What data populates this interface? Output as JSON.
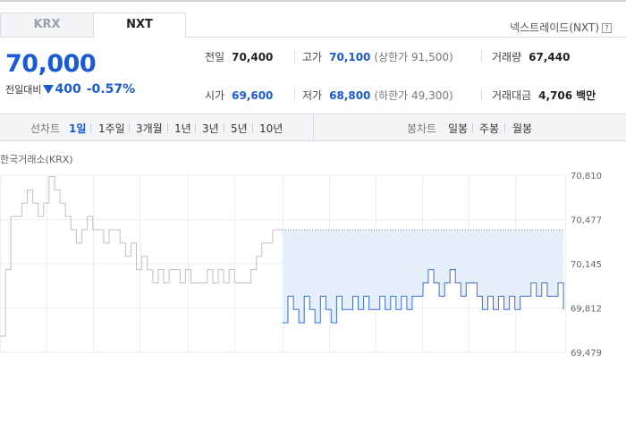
{
  "tabs": [
    {
      "label": "KRX",
      "active": false
    },
    {
      "label": "NXT",
      "active": true
    }
  ],
  "market_label": "넥스트레이드(NXT)",
  "help_glyph": "?",
  "price": {
    "current": "70,000",
    "change_label": "전일대비",
    "change_amount": "400",
    "change_percent": "-0.57%",
    "direction": "down"
  },
  "stats": {
    "prev_close": {
      "label": "전일",
      "value": "70,400"
    },
    "high": {
      "label": "고가",
      "value": "70,100",
      "sub": "(상한가 91,500)"
    },
    "volume": {
      "label": "거래량",
      "value": "67,440"
    },
    "open": {
      "label": "시가",
      "value": "69,600"
    },
    "low": {
      "label": "저가",
      "value": "68,800",
      "sub": "(하한가 49,300)"
    },
    "amount": {
      "label": "거래대금",
      "value": "4,706",
      "unit": "백만"
    }
  },
  "toolbar": {
    "line_chart_label": "선차트",
    "periods": [
      "1일",
      "1주일",
      "3개월",
      "1년",
      "3년",
      "5년",
      "10년"
    ],
    "active_period": "1일",
    "candle_chart_label": "봉차트",
    "candle_periods": [
      "일봉",
      "주봉",
      "월봉"
    ]
  },
  "chart_exchange_label": "한국거래소(KRX)",
  "colors": {
    "accent": "#1a5ad6",
    "krx_line": "#c0c0c0",
    "nxt_line": "#3a6fd8",
    "nxt_fill": "#e6eefa"
  },
  "chart_data": {
    "type": "line",
    "title": "",
    "xlabel": "",
    "ylabel": "",
    "ylim": [
      69479,
      70810
    ],
    "yticks": [
      "70,810",
      "70,477",
      "70,145",
      "69,812",
      "69,479"
    ],
    "ytick_values": [
      70810,
      70477,
      70145,
      69812,
      69479
    ],
    "grid": true,
    "reference_line": 70400,
    "series": [
      {
        "name": "",
        "style": "gray",
        "x_start": 0,
        "x_end": 305,
        "values": [
          69600,
          70100,
          70500,
          70500,
          70600,
          70700,
          70600,
          70500,
          70600,
          70800,
          70700,
          70600,
          70500,
          70400,
          70300,
          70400,
          70500,
          70400,
          70400,
          70300,
          70400,
          70400,
          70300,
          70200,
          70300,
          70100,
          70200,
          70100,
          70000,
          70100,
          70000,
          70100,
          70100,
          70000,
          70100,
          70000,
          70000,
          70000,
          70100,
          70000,
          70100,
          70000,
          70100,
          70000,
          70000,
          70000,
          70100,
          70200,
          70300,
          70300,
          70400
        ]
      },
      {
        "name": "",
        "style": "blue",
        "x_start": 316,
        "x_end": 630,
        "values": [
          69700,
          69900,
          69800,
          69700,
          69900,
          69800,
          69700,
          69900,
          69800,
          69700,
          69900,
          69800,
          69800,
          69900,
          69800,
          69900,
          69800,
          69800,
          69900,
          69800,
          69900,
          69800,
          69900,
          69800,
          69900,
          69900,
          70000,
          70100,
          70000,
          69900,
          70000,
          70100,
          70000,
          69900,
          70000,
          70000,
          69900,
          69800,
          69900,
          69800,
          69900,
          69800,
          69900,
          69800,
          69900,
          69900,
          70000,
          69900,
          70000,
          69900,
          69900,
          70000,
          69800
        ]
      }
    ]
  }
}
